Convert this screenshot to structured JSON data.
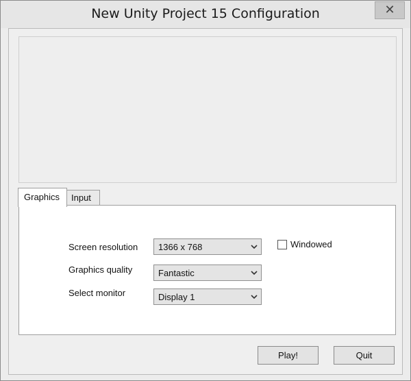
{
  "window": {
    "title": "New Unity Project 15 Configuration",
    "close_icon": "close-icon"
  },
  "tabs": [
    {
      "label": "Graphics",
      "active": true
    },
    {
      "label": "Input",
      "active": false
    }
  ],
  "graphics": {
    "screen_resolution": {
      "label": "Screen resolution",
      "value": "1366 x 768"
    },
    "graphics_quality": {
      "label": "Graphics quality",
      "value": "Fantastic"
    },
    "select_monitor": {
      "label": "Select monitor",
      "value": "Display 1"
    },
    "windowed": {
      "label": "Windowed",
      "checked": false
    }
  },
  "buttons": {
    "play": "Play!",
    "quit": "Quit"
  }
}
